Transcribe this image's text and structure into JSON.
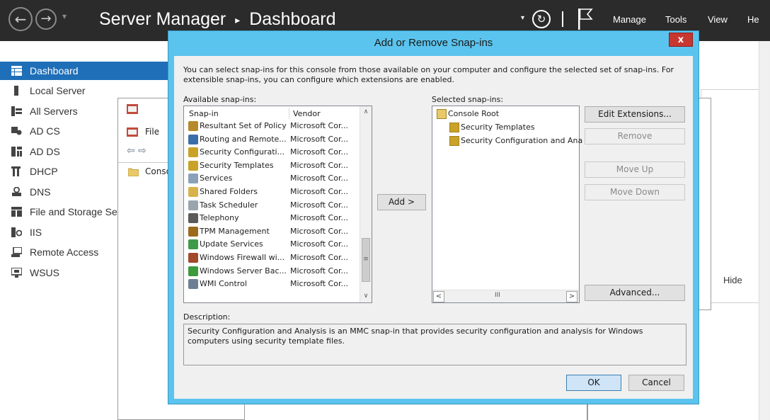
{
  "header": {
    "app": "Server Manager",
    "separator": "▸",
    "page": "Dashboard",
    "back_icon": "←",
    "forward_icon": "→",
    "dropdown_icon": "▾",
    "refresh_icon": "↻",
    "menus": [
      "Manage",
      "Tools",
      "View",
      "He"
    ]
  },
  "sidebar": {
    "items": [
      {
        "label": "Dashboard",
        "active": true
      },
      {
        "label": "Local Server"
      },
      {
        "label": "All Servers"
      },
      {
        "label": "AD CS"
      },
      {
        "label": "AD DS"
      },
      {
        "label": "DHCP"
      },
      {
        "label": "DNS"
      },
      {
        "label": "File and Storage Se"
      },
      {
        "label": "IIS"
      },
      {
        "label": "Remote Access"
      },
      {
        "label": "WSUS"
      }
    ]
  },
  "bg_mmc": {
    "menu_file": "File",
    "nav_arrows": "⇦ ⇨",
    "console_item": "Conso"
  },
  "right_area": {
    "hide": "Hide"
  },
  "dialog": {
    "title": "Add or Remove Snap-ins",
    "close": "x",
    "intro_line1": "You can select snap-ins for this console from those available on your computer and configure the selected set of snap-ins. For",
    "intro_line2": "extensible snap-ins, you can configure which extensions are enabled.",
    "available_label": "Available snap-ins:",
    "selected_label": "Selected snap-ins:",
    "col_snapin": "Snap-in",
    "col_vendor": "Vendor",
    "available": [
      {
        "name": "Resultant Set of Policy",
        "vendor": "Microsoft Cor...",
        "icon": "policy-icon",
        "color": "#b5892c"
      },
      {
        "name": "Routing and Remote...",
        "vendor": "Microsoft Cor...",
        "icon": "routing-icon",
        "color": "#3b6ea8"
      },
      {
        "name": "Security Configurati...",
        "vendor": "Microsoft Cor...",
        "icon": "security-config-icon",
        "color": "#c9a227"
      },
      {
        "name": "Security Templates",
        "vendor": "Microsoft Cor...",
        "icon": "security-template-icon",
        "color": "#c9a227"
      },
      {
        "name": "Services",
        "vendor": "Microsoft Cor...",
        "icon": "services-icon",
        "color": "#8aa1b8"
      },
      {
        "name": "Shared Folders",
        "vendor": "Microsoft Cor...",
        "icon": "shared-folder-icon",
        "color": "#d8b24a"
      },
      {
        "name": "Task Scheduler",
        "vendor": "Microsoft Cor...",
        "icon": "clock-icon",
        "color": "#9aa4ad"
      },
      {
        "name": "Telephony",
        "vendor": "Microsoft Cor...",
        "icon": "telephony-icon",
        "color": "#5a5a5a"
      },
      {
        "name": "TPM Management",
        "vendor": "Microsoft Cor...",
        "icon": "tpm-icon",
        "color": "#9c6a1c"
      },
      {
        "name": "Update Services",
        "vendor": "Microsoft Cor...",
        "icon": "update-icon",
        "color": "#3e9a4a"
      },
      {
        "name": "Windows Firewall wi...",
        "vendor": "Microsoft Cor...",
        "icon": "firewall-icon",
        "color": "#a24a2a"
      },
      {
        "name": "Windows Server Bac...",
        "vendor": "Microsoft Cor...",
        "icon": "backup-icon",
        "color": "#3d9a3d"
      },
      {
        "name": "WMI Control",
        "vendor": "Microsoft Cor...",
        "icon": "wmi-icon",
        "color": "#6d7f93"
      }
    ],
    "add_button": "Add >",
    "selected_tree": [
      {
        "name": "Console Root",
        "icon": "folder-icon",
        "level": 0
      },
      {
        "name": "Security Templates",
        "icon": "security-template-icon",
        "level": 1
      },
      {
        "name": "Security Configuration and Ana",
        "icon": "security-config-icon",
        "level": 1
      }
    ],
    "edit_extensions": "Edit Extensions...",
    "remove": "Remove",
    "move_up": "Move Up",
    "move_down": "Move Down",
    "advanced": "Advanced...",
    "description_label": "Description:",
    "description_text": "Security Configuration and Analysis is an MMC snap-in that provides security configuration and analysis for Windows computers using security template files.",
    "ok": "OK",
    "cancel": "Cancel",
    "hscroll_left": "<",
    "hscroll_right": ">",
    "hscroll_mid": "III",
    "vscroll_up": "∧",
    "vscroll_down": "∨",
    "vscroll_grip": "≡"
  }
}
